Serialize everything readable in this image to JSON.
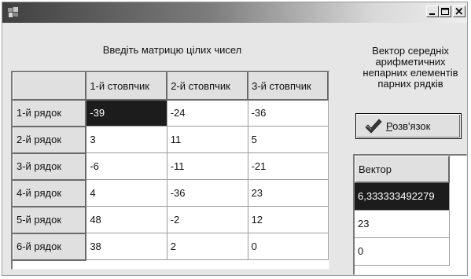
{
  "window": {
    "title": "",
    "minimize_icon": "minimize-icon",
    "maximize_icon": "maximize-icon",
    "close_icon": "close-icon",
    "app_icon": "app-icon"
  },
  "matrix_panel": {
    "caption": "Введіть матрицю цілих чисел",
    "columns": [
      "1-й стовпчик",
      "2-й стовпчик",
      "3-й стовпчик"
    ],
    "rows": [
      {
        "label": "1-й рядок",
        "values": [
          "-39",
          "-24",
          "-36"
        ]
      },
      {
        "label": "2-й рядок",
        "values": [
          "3",
          "11",
          "5"
        ]
      },
      {
        "label": "3-й рядок",
        "values": [
          "-6",
          "-11",
          "-21"
        ]
      },
      {
        "label": "4-й рядок",
        "values": [
          "4",
          "-36",
          "23"
        ]
      },
      {
        "label": "5-й рядок",
        "values": [
          "48",
          "-2",
          "12"
        ]
      },
      {
        "label": "6-й рядок",
        "values": [
          "38",
          "2",
          "0"
        ]
      }
    ],
    "selected_cell": {
      "row": 1,
      "column": 1
    }
  },
  "result_panel": {
    "caption_lines": [
      "Вектор середніх",
      "арифметичних",
      "непарних елементів",
      "парних рядків"
    ],
    "solve_button": {
      "access_key": "Р",
      "label_rest": "озв'язок",
      "icon": "checkmark-icon"
    },
    "vector": {
      "header": "Вектор",
      "values": [
        "6,333333492279",
        "23",
        "0"
      ],
      "selected_row": 1
    }
  },
  "colors": {
    "selection": "#1c1c1c",
    "face": "#e0e0e0",
    "window_bg": "#e6e6e6",
    "check_green": "#3a3a3a"
  }
}
